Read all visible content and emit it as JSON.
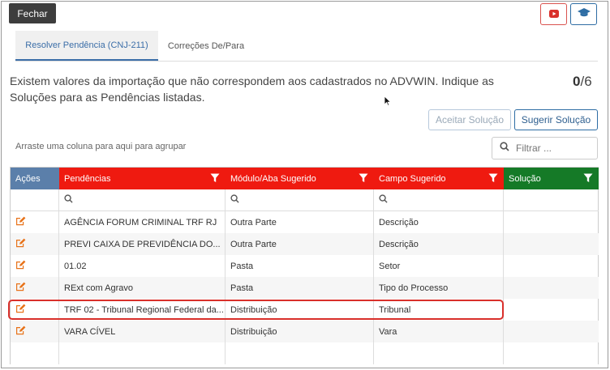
{
  "toolbar": {
    "close_label": "Fechar",
    "video_icon": "youtube-icon",
    "help_icon": "graduation-cap-icon"
  },
  "tabs": [
    {
      "label": "Resolver Pendência (CNJ-211)",
      "active": true
    },
    {
      "label": "Correções De/Para",
      "active": false
    }
  ],
  "message": "Existem valores da importação que não correspondem aos cadastrados no ADVWIN. Indique as Soluções para as Pendências listadas.",
  "counter": {
    "resolved": "0",
    "total": "/6"
  },
  "actions": {
    "accept_label": "Aceitar Solução",
    "suggest_label": "Sugerir Solução"
  },
  "grid": {
    "group_hint": "Arraste uma coluna para aqui para agrupar",
    "filter_placeholder": "Filtrar ...",
    "columns": [
      "Ações",
      "Pendências",
      "Módulo/Aba Sugerido",
      "Campo Sugerido",
      "Solução"
    ],
    "column_colors": {
      "acoes": "#5b7faa",
      "pendencias": "#ef1a10",
      "modulo": "#ef1a10",
      "campo": "#ef1a10",
      "solucao": "#157a27"
    },
    "rows": [
      {
        "pendencia": "AGÊNCIA FORUM CRIMINAL TRF RJ",
        "modulo": "Outra Parte",
        "campo": "Descrição",
        "solucao": ""
      },
      {
        "pendencia": "PREVI CAIXA DE PREVIDÊNCIA DO...",
        "modulo": "Outra Parte",
        "campo": "Descrição",
        "solucao": ""
      },
      {
        "pendencia": "01.02",
        "modulo": "Pasta",
        "campo": "Setor",
        "solucao": ""
      },
      {
        "pendencia": "RExt com Agravo",
        "modulo": "Pasta",
        "campo": "Tipo do Processo",
        "solucao": ""
      },
      {
        "pendencia": "TRF 02 - Tribunal Regional Federal da...",
        "modulo": "Distribuição",
        "campo": "Tribunal",
        "solucao": ""
      },
      {
        "pendencia": "VARA CÍVEL",
        "modulo": "Distribuição",
        "campo": "Vara",
        "solucao": ""
      }
    ]
  }
}
